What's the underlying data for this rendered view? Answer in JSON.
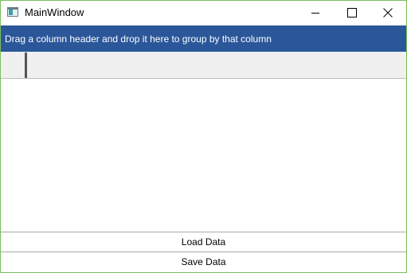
{
  "window": {
    "title": "MainWindow",
    "icon": "app-window-icon",
    "controls": {
      "minimize_icon": "minimize-icon",
      "maximize_icon": "maximize-icon",
      "close_icon": "close-icon"
    }
  },
  "grid": {
    "group_panel_text": "Drag a column header and drop it here to group by that column",
    "accent_color": "#2b579a"
  },
  "buttons": {
    "load_label": "Load Data",
    "save_label": "Save Data"
  }
}
